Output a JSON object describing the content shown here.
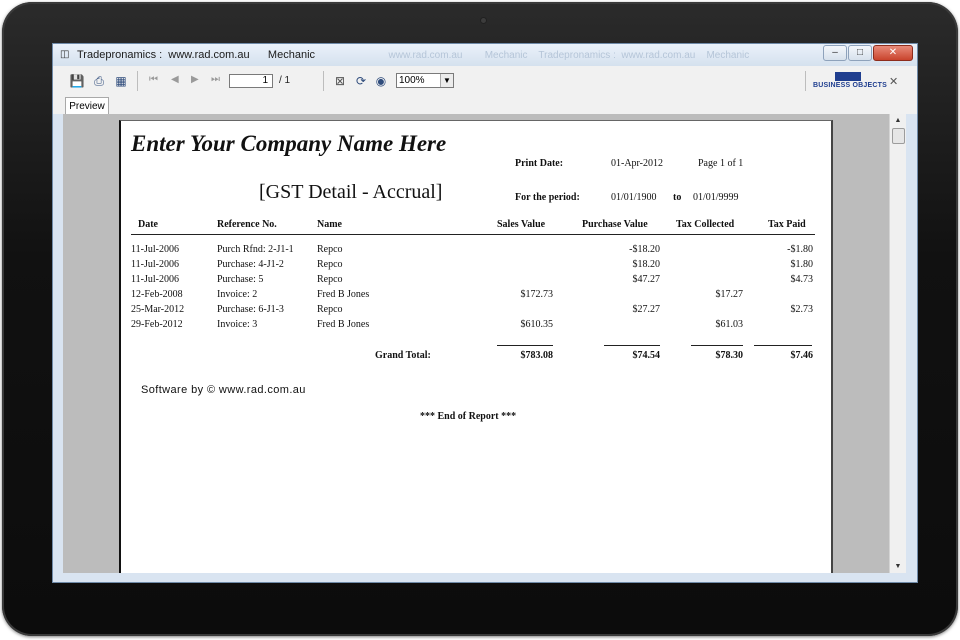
{
  "window": {
    "title": "Tradepronamics :  www.rad.com.au      Mechanic",
    "title_ghost": "  www.rad.com.au        Mechanic    Tradepronamics :  www.rad.com.au    Mechanic"
  },
  "toolbar": {
    "page_current": "1",
    "page_total": "/ 1",
    "zoom": "100%",
    "logo_text": "BUSINESS OBJECTS"
  },
  "tabs": [
    {
      "label": "Preview"
    }
  ],
  "report": {
    "company": "Enter Your Company Name Here",
    "title": "[GST Detail - Accrual]",
    "print_date_label": "Print Date:",
    "print_date": "01-Apr-2012",
    "page_info": "Page 1 of 1",
    "period_label": "For the period:",
    "period_from": "01/01/1900",
    "period_to_label": "to",
    "period_to": "01/01/9999",
    "columns": [
      "Date",
      "Reference No.",
      "Name",
      "Sales Value",
      "Purchase Value",
      "Tax Collected",
      "Tax Paid"
    ],
    "rows": [
      {
        "date": "11-Jul-2006",
        "ref": "Purch Rfnd: 2-J1-1",
        "name": "Repco",
        "sales": "",
        "purchase": "-$18.20",
        "collected": "",
        "paid": "-$1.80"
      },
      {
        "date": "11-Jul-2006",
        "ref": "Purchase: 4-J1-2",
        "name": "Repco",
        "sales": "",
        "purchase": "$18.20",
        "collected": "",
        "paid": "$1.80"
      },
      {
        "date": "11-Jul-2006",
        "ref": "Purchase: 5",
        "name": "Repco",
        "sales": "",
        "purchase": "$47.27",
        "collected": "",
        "paid": "$4.73"
      },
      {
        "date": "12-Feb-2008",
        "ref": "Invoice: 2",
        "name": "Fred B Jones",
        "sales": "$172.73",
        "purchase": "",
        "collected": "$17.27",
        "paid": ""
      },
      {
        "date": "25-Mar-2012",
        "ref": "Purchase: 6-J1-3",
        "name": "Repco",
        "sales": "",
        "purchase": "$27.27",
        "collected": "",
        "paid": "$2.73"
      },
      {
        "date": "29-Feb-2012",
        "ref": "Invoice: 3",
        "name": "Fred B Jones",
        "sales": "$610.35",
        "purchase": "",
        "collected": "$61.03",
        "paid": ""
      }
    ],
    "grand_total_label": "Grand Total:",
    "totals": {
      "sales": "$783.08",
      "purchase": "$74.54",
      "collected": "$78.30",
      "paid": "$7.46"
    },
    "software_credit": "Software by ©  www.rad.com.au",
    "end_text": "*** End of Report ***"
  },
  "colors": {
    "brand_blue": "#1f3e8f",
    "window_frame": "#d9e4f1"
  }
}
